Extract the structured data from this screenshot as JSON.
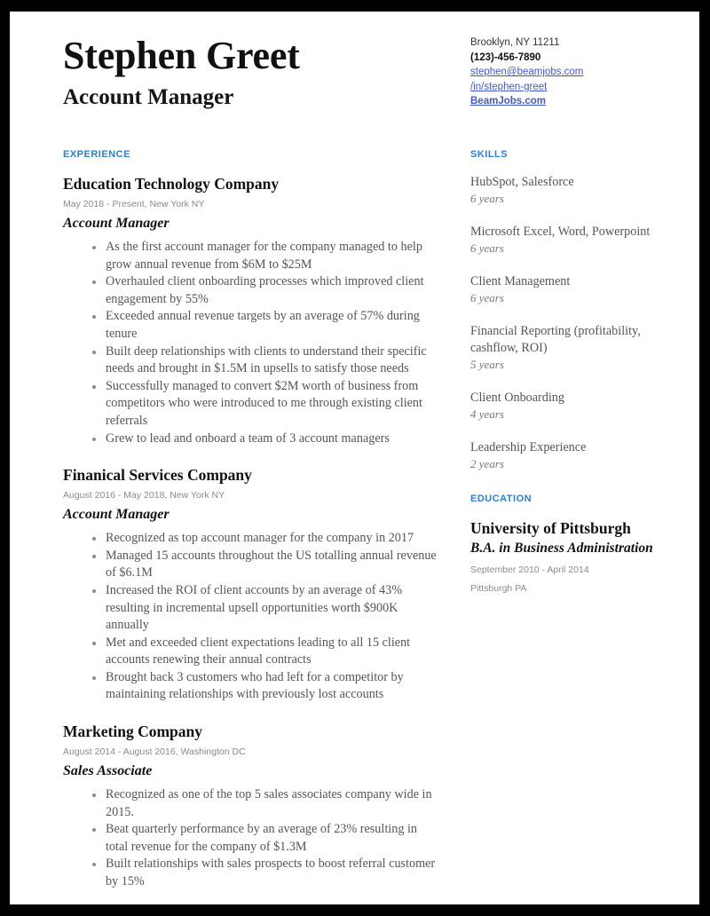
{
  "header": {
    "name": "Stephen Greet",
    "title": "Account Manager"
  },
  "contact": {
    "location": "Brooklyn, NY 11211",
    "phone": "(123)-456-7890",
    "email": "stephen@beamjobs.com",
    "linkedin": "/in/stephen-greet",
    "website": "BeamJobs.com"
  },
  "colors": {
    "accent": "#2d7dd2",
    "link": "#4158d0",
    "body_text": "#555555",
    "meta_text": "#8a8a8a",
    "page_background": "#ffffff",
    "frame": "#000000"
  },
  "experience": {
    "heading": "EXPERIENCE",
    "jobs": [
      {
        "company": "Education Technology Company",
        "meta": "May 2018 - Present, New York NY",
        "role": "Account Manager",
        "bullets": [
          "As the first account manager for the company managed to help grow annual revenue from $6M to $25M",
          "Overhauled client onboarding processes which improved client engagement by 55%",
          "Exceeded annual revenue targets by an average of 57% during tenure",
          "Built deep relationships with clients to understand their specific needs and brought in $1.5M in upsells to satisfy those needs",
          "Successfully managed to convert $2M worth of business from competitors who were introduced to me through existing client referrals",
          "Grew to lead and onboard a team of 3 account managers"
        ]
      },
      {
        "company": "Finanical Services Company",
        "meta": "August 2016 - May 2018, New York NY",
        "role": "Account Manager",
        "bullets": [
          "Recognized as top account manager for the company in 2017",
          "Managed 15 accounts throughout the US totalling annual revenue of $6.1M",
          "Increased the ROI of client accounts by an average of 43% resulting in incremental upsell opportunities worth $900K annually",
          "Met and  exceeded client expectations leading to all 15 client accounts renewing their annual contracts",
          "Brought back 3 customers who had left for a competitor by maintaining relationships with previously lost accounts"
        ]
      },
      {
        "company": "Marketing Company",
        "meta": "August 2014 - August 2016, Washington DC",
        "role": "Sales Associate",
        "bullets": [
          "Recognized as one of the top 5 sales associates company wide in 2015.",
          "Beat quarterly performance by an average of 23% resulting in total revenue for the company of $1.3M",
          "Built relationships with sales prospects to boost referral customer by 15%"
        ]
      }
    ]
  },
  "skills": {
    "heading": "SKILLS",
    "items": [
      {
        "name": "HubSpot, Salesforce",
        "years": "6 years"
      },
      {
        "name": "Microsoft Excel, Word, Powerpoint",
        "years": "6 years"
      },
      {
        "name": "Client Management",
        "years": "6 years"
      },
      {
        "name": "Financial Reporting (profitability, cashflow, ROI)",
        "years": "5 years"
      },
      {
        "name": "Client Onboarding",
        "years": "4 years"
      },
      {
        "name": "Leadership Experience",
        "years": "2 years"
      }
    ]
  },
  "education": {
    "heading": "EDUCATION",
    "school": "University of Pittsburgh",
    "degree": "B.A. in Business Administration",
    "dates": "September 2010 - April 2014",
    "location": "Pittsburgh PA"
  }
}
